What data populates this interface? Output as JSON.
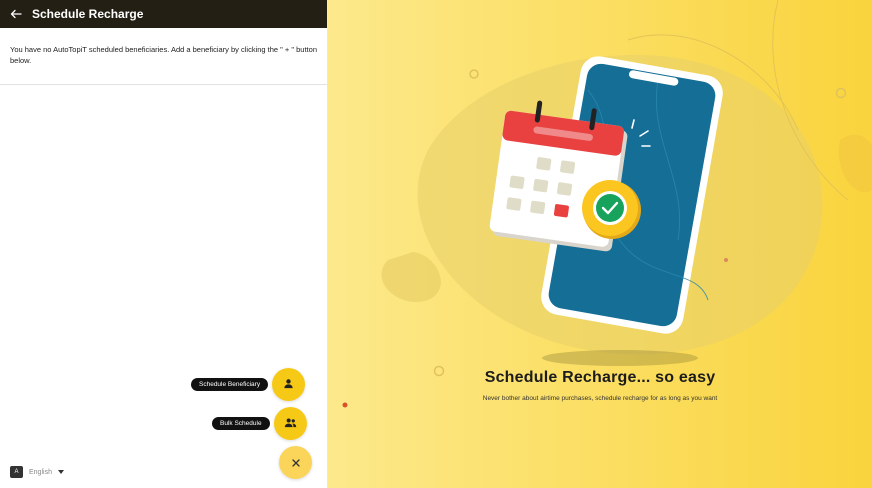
{
  "header": {
    "title": "Schedule Recharge"
  },
  "empty_state": {
    "message": "You have no AutoTopiT scheduled beneficiaries. Add a beneficiary by clicking the \" + \" button below."
  },
  "fab_menu": {
    "schedule_beneficiary_label": "Schedule Beneficiary",
    "bulk_schedule_label": "Bulk Schedule"
  },
  "language": {
    "selected": "English"
  },
  "promo": {
    "title": "Schedule Recharge... so easy",
    "subtitle": "Never bother about airtime purchases, schedule recharge for as long as you want"
  },
  "colors": {
    "accent": "#f7c917",
    "header_bg": "#231f14",
    "phone_screen": "#146e96",
    "calendar_red": "#e94040",
    "check_green": "#17a35c"
  },
  "icons": [
    "back-arrow-icon",
    "person-icon",
    "group-icon",
    "close-icon",
    "translate-icon",
    "caret-down-icon",
    "phone-illustration",
    "calendar-illustration",
    "check-badge-icon"
  ]
}
